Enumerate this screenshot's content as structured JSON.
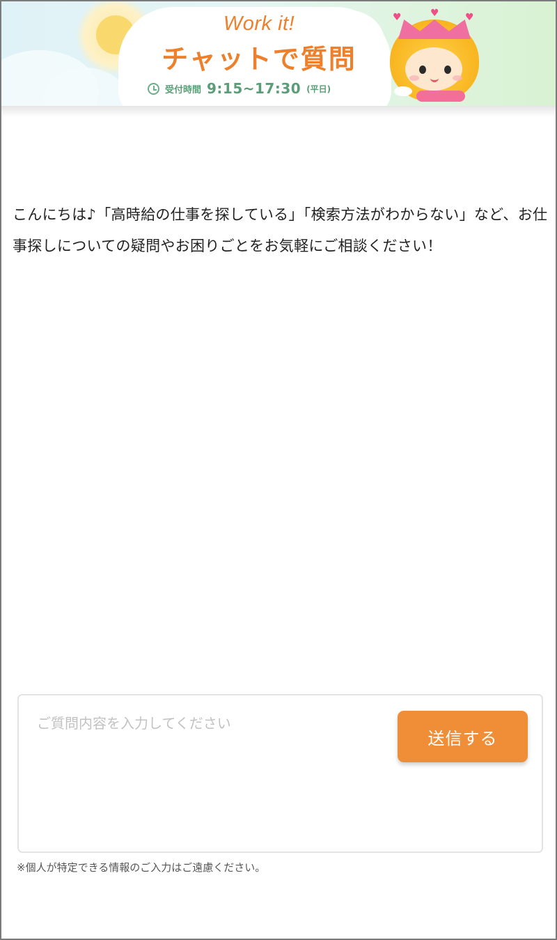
{
  "header": {
    "brand": "Work it!",
    "chat_title": "チャットで質問",
    "hours_label": "受付時間",
    "hours_time": "9:15~17:30",
    "hours_note": "(平日)",
    "icons": [
      "clock-icon",
      "sun",
      "mascot"
    ]
  },
  "message": {
    "text": "こんにちは♪「高時給の仕事を探している」「検索方法がわからない」など、お仕事探しについての疑問やお困りごとをお気軽にご相談ください！"
  },
  "input": {
    "placeholder": "ご質問内容を入力してください",
    "value": ""
  },
  "send_button": {
    "label": "送信する"
  },
  "privacy_note": "※個人が特定できる情報のご入力はご遠慮ください。",
  "colors": {
    "accent": "#f08e38",
    "brand_orange": "#ee7f2b",
    "hours_green": "#5a9d77",
    "text": "#222222",
    "placeholder": "#c2c2c2"
  }
}
